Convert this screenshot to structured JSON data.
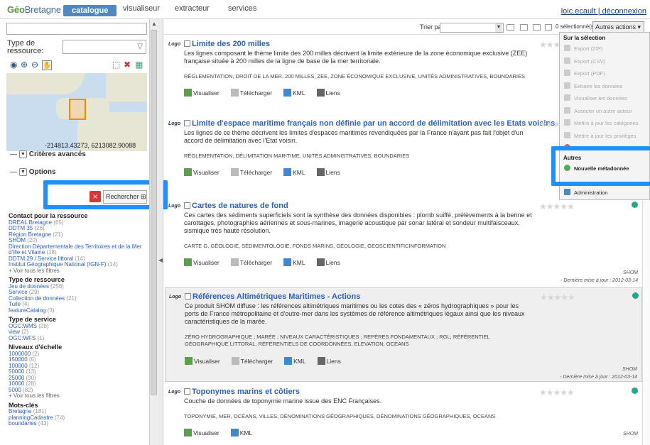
{
  "header": {
    "logo_geo": "Géo",
    "logo_rest": "Bretagne",
    "nav": [
      "catalogue",
      "visualiseur",
      "extracteur",
      "services"
    ],
    "user": "loic.ecault",
    "sep": "|",
    "logout": "déconnexion"
  },
  "search": {
    "placeholder": "",
    "type_label_1": "Type de",
    "type_label_2": "ressource:",
    "map_coords": "-214813.43273, 6213082.90088",
    "criteria": "Critères avancés",
    "options": "Options",
    "clear_icon": "×",
    "search_btn": "Rechercher"
  },
  "facets": [
    {
      "title": "Contact pour la ressource",
      "items": [
        [
          "DREAL Bretagne",
          "(65)"
        ],
        [
          "DDTM 35",
          "(26)"
        ],
        [
          "Région Bretagne",
          "(21)"
        ],
        [
          "SHOM",
          "(20)"
        ],
        [
          "Direction Départementale des Territoires et de la Mer",
          ""
        ],
        [
          "d'Ille et Vilaine",
          "(18)"
        ],
        [
          "DDTM 29 / Service littoral",
          "(14)"
        ],
        [
          "Institut Géographique National (IGN-F)",
          "(14)"
        ]
      ],
      "more": "+ Voir tous les filtres"
    },
    {
      "title": "Type de ressource",
      "items": [
        [
          "Jeu de données",
          "(258)"
        ],
        [
          "Service",
          "(29)"
        ],
        [
          "Collection de données",
          "(21)"
        ],
        [
          "Tuile",
          "(4)"
        ],
        [
          "featureCatalog",
          "(3)"
        ]
      ],
      "more": ""
    },
    {
      "title": "Type de service",
      "items": [
        [
          "OGC:WMS",
          "(26)"
        ],
        [
          "view",
          "(2)"
        ],
        [
          "OGC:WFS",
          "(1)"
        ]
      ],
      "more": ""
    },
    {
      "title": "Niveaux d'échelle",
      "items": [
        [
          "1000000",
          "(2)"
        ],
        [
          "150000",
          "(5)"
        ],
        [
          "100000",
          "(12)"
        ],
        [
          "50000",
          "(13)"
        ],
        [
          "25000",
          "(90)"
        ],
        [
          "10000",
          "(28)"
        ],
        [
          "5000",
          "(82)"
        ]
      ],
      "more": "+ Voir tous les filtres"
    },
    {
      "title": "Mots-clés",
      "items": [
        [
          "Bretagne",
          "(181)"
        ],
        [
          "planningCadastre",
          "(74)"
        ],
        [
          "boundaries",
          "(43)"
        ]
      ],
      "more": ""
    }
  ],
  "toolbar": {
    "sort_label": "Trier par",
    "selected": "0 sélectionné(s) ▾",
    "other_actions": "Autres actions ▾"
  },
  "results": [
    {
      "logo": "Logo",
      "title": "Limite des 200 milles",
      "desc": "Les lignes composant le thème limite des 200 milles décrivent la limite extérieure de la zone économique exclusive (ZEE) française située à 200 milles de la ligne de base de la mer territoriale.",
      "keywords": "RÉGLEMENTATION, DROIT DE LA MER, 200 MILLES, ZEE, ZONE ÉCONOMIQUE EXCLUSIVE, UNITÉS ADMINISTRATIVES, BOUNDARIES",
      "actions": [
        "Visualiser",
        "Télécharger",
        "KML",
        "Liens"
      ],
      "source": "",
      "updated": ""
    },
    {
      "logo": "Logo",
      "title": "Limite d'espace maritime français non définie par un accord de délimitation avec les Etats voisins",
      "desc": "Les lignes de ce thème décrivent les limites d'espaces maritimes revendiquées par la France n'ayant pas fait l'objet d'un accord de délimitation avec l'Etat voisin.",
      "keywords": "RÉGLEMENTATION, DÉLIMITATION MARITIME, UNITÉS ADMINISTRATIVES, BOUNDARIES",
      "actions": [
        "Visualiser",
        "Télécharger",
        "KML",
        "Liens"
      ],
      "source": "",
      "updated": ""
    },
    {
      "logo": "Logo",
      "title": "Cartes de natures de fond",
      "desc": "Ces cartes des sédiments superficiels sont la synthèse des données disponibles : plomb suiffé, prélèvements à la benne et carottages, photographies aériennes et sous-marines, imagerie acoustique par sonar latéral et sondeur multifaisceaux, sismique très haute résolution.",
      "keywords": "CARTE G, GÉOLOGIE, SÉDIMENTOLOGIE, FONDS MARINS, GÉOLOGIE, GEOSCIENTIFICINFORMATION",
      "actions": [
        "Visualiser",
        "Télécharger",
        "KML",
        "Liens"
      ],
      "source": "SHOM",
      "updated": "- Dernière mise à jour : 2012-03-14"
    },
    {
      "logo": "Logo",
      "title": "Références Altimétriques Maritimes - Actions",
      "desc": "Ce produit SHOM diffuse : les références altimétriques maritimes ou les cotes des « zéros hydrographiques » pour les ports de France métropolitaine et d'outre-mer dans les systèmes de référence altimétriques légaux ainsi que les niveaux caractéristiques de la marée.",
      "keywords": "ZÉRO HYDROGRAPHIQUE ; MARÉE ; NIVEAUX CARACTÉRISTIQUES ; REPÈRES FONDAMENTAUX ; RGL; RÉFÉRENTIEL GÉOGRAPHIQUE LITTORAL, RÉFÉRENTIELS DE COORDONNÉES, ELEVATION, OCEANS",
      "actions": [
        "Visualiser",
        "Télécharger",
        "KML",
        "Liens"
      ],
      "source": "SHOM",
      "updated": "- Dernière mise à jour : 2012-03-14"
    },
    {
      "logo": "Logo",
      "title": "Toponymes marins et côtiers",
      "desc": "Couche de données de toponymie marine issue des ENC Françaises.",
      "keywords": "TOPONYMIE, MER, OCÉANS, VILLES, DÉNOMINATIONS GÉOGRAPHIQUES, DÉNOMINATIONS GÉOGRAPHIQUES, OCEANS",
      "actions": [
        "Visualiser",
        "KML"
      ],
      "source": "SHOM",
      "updated": ""
    }
  ],
  "menu": {
    "head1": "Sur la sélection",
    "items1": [
      "Export (ZIP)",
      "Export (CSV)",
      "Export (PDF)",
      "Extraire les données",
      "Visualiser les données",
      "Associer un autre auteur",
      "Mettre à jour les catégories",
      "Mettre à jour les privilèges",
      "Supprimer"
    ],
    "head2": "Autres",
    "new_md": "Nouvelle métadonnée",
    "admin": "Administration"
  }
}
